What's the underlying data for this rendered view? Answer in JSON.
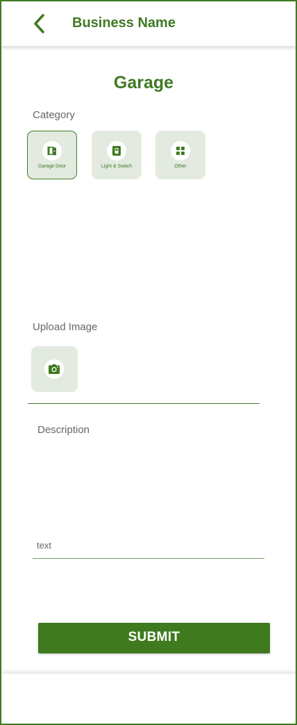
{
  "header": {
    "title": "Business Name",
    "back_icon": "chevron-left-icon"
  },
  "page": {
    "title": "Garage"
  },
  "category": {
    "label": "Category",
    "items": [
      {
        "label": "Garage Door",
        "icon": "door-icon",
        "selected": true
      },
      {
        "label": "Light & Switch",
        "icon": "switch-icon",
        "selected": false
      },
      {
        "label": "Other",
        "icon": "grid-icon",
        "selected": false
      }
    ]
  },
  "upload": {
    "label": "Upload Image",
    "icon": "camera-icon"
  },
  "description": {
    "label": "Description",
    "placeholder": "text"
  },
  "submit": {
    "label": "SUBMIT"
  },
  "colors": {
    "brand": "#3f7a22",
    "tile_bg": "#e3ebe0",
    "label_gray": "#666666"
  }
}
